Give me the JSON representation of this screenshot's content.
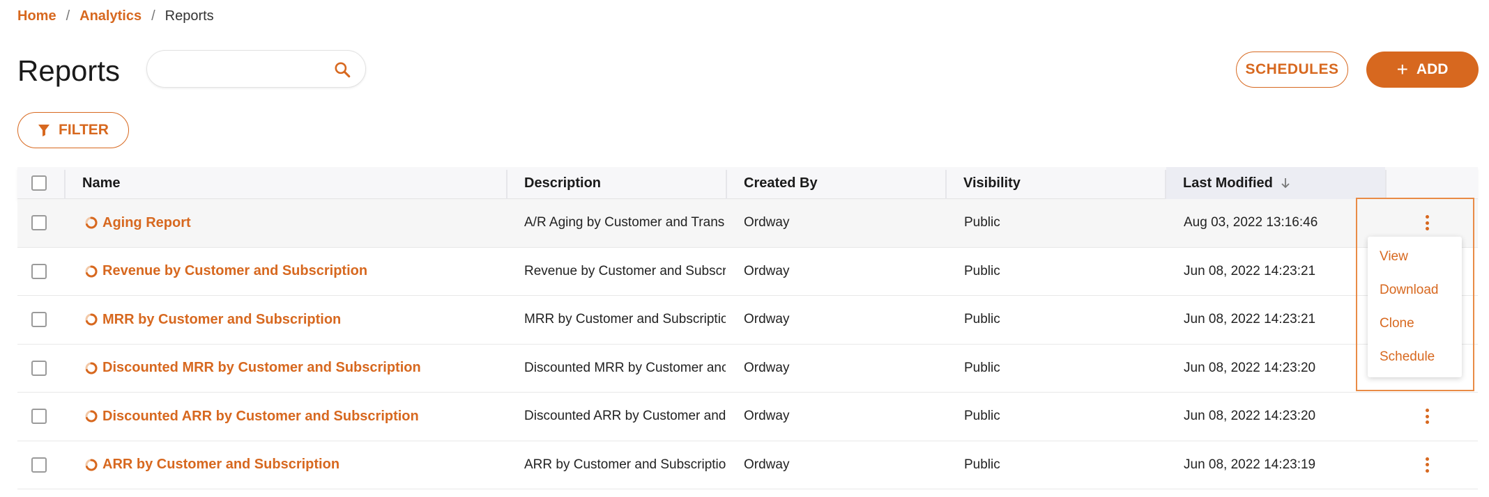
{
  "breadcrumb": {
    "home": "Home",
    "analytics": "Analytics",
    "current": "Reports",
    "separator": "/"
  },
  "page": {
    "title": "Reports"
  },
  "search": {
    "placeholder": "",
    "value": ""
  },
  "toolbar": {
    "schedules_label": "SCHEDULES",
    "add_label": "ADD",
    "filter_label": "FILTER"
  },
  "table": {
    "columns": [
      "Name",
      "Description",
      "Created By",
      "Visibility",
      "Last Modified"
    ],
    "sort": {
      "column": "Last Modified",
      "direction": "desc"
    },
    "rows": [
      {
        "name": "Aging Report",
        "description": "A/R Aging by Customer and Trans",
        "created_by": "Ordway",
        "visibility": "Public",
        "last_modified": "Aug 03, 2022 13:16:46"
      },
      {
        "name": "Revenue by Customer and Subscription",
        "description": "Revenue by Customer and Subscri",
        "created_by": "Ordway",
        "visibility": "Public",
        "last_modified": "Jun 08, 2022 14:23:21"
      },
      {
        "name": "MRR by Customer and Subscription",
        "description": "MRR by Customer and Subscriptio",
        "created_by": "Ordway",
        "visibility": "Public",
        "last_modified": "Jun 08, 2022 14:23:21"
      },
      {
        "name": "Discounted MRR by Customer and Subscription",
        "description": "Discounted MRR by Customer anc",
        "created_by": "Ordway",
        "visibility": "Public",
        "last_modified": "Jun 08, 2022 14:23:20"
      },
      {
        "name": "Discounted ARR by Customer and Subscription",
        "description": "Discounted ARR by Customer and",
        "created_by": "Ordway",
        "visibility": "Public",
        "last_modified": "Jun 08, 2022 14:23:20"
      },
      {
        "name": "ARR by Customer and Subscription",
        "description": "ARR by Customer and Subscriptio",
        "created_by": "Ordway",
        "visibility": "Public",
        "last_modified": "Jun 08, 2022 14:23:19"
      }
    ]
  },
  "row_menu": {
    "items": [
      "View",
      "Download",
      "Clone",
      "Schedule"
    ]
  },
  "colors": {
    "accent": "#d7681f",
    "highlight": "#e98b46"
  }
}
